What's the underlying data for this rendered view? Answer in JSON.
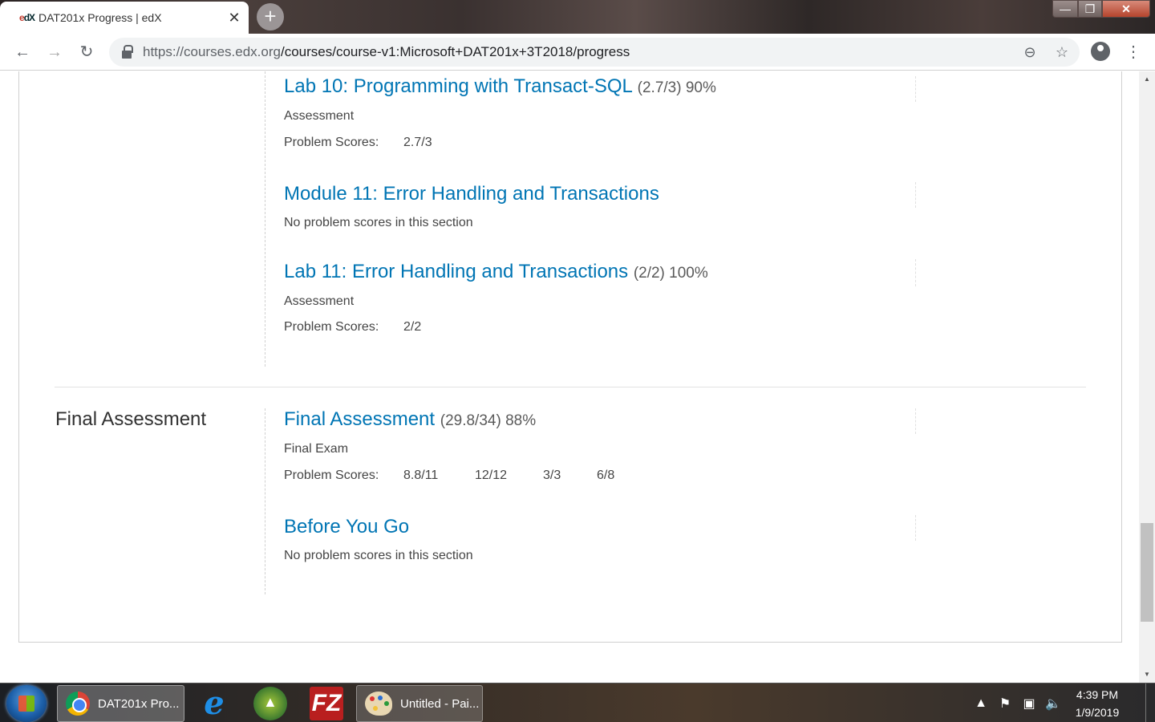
{
  "browser": {
    "tab_title": "DAT201x Progress | edX",
    "favicon_text": "edX",
    "tab_close": "✕",
    "new_tab": "+",
    "url_host": "https://courses.edx.org",
    "url_path": "/courses/course-v1:Microsoft+DAT201x+3T2018/progress",
    "win_min": "—",
    "win_max": "❐",
    "win_close": "✕",
    "back": "←",
    "forward": "→",
    "reload": "↻",
    "zoom": "⊖",
    "star": "☆",
    "menu": "⋮"
  },
  "sections": [
    {
      "title": "Lab 10: Programming with Transact-SQL",
      "score": "(2.7/3) 90%",
      "format": "Assessment",
      "problem_scores_label": "Problem Scores:",
      "problem_scores": [
        "2.7/3"
      ]
    },
    {
      "title": "Module 11: Error Handling and Transactions",
      "note": "No problem scores in this section"
    },
    {
      "title": "Lab 11: Error Handling and Transactions",
      "score": "(2/2) 100%",
      "format": "Assessment",
      "problem_scores_label": "Problem Scores:",
      "problem_scores": [
        "2/2"
      ]
    }
  ],
  "final_chapter": {
    "title": "Final Assessment",
    "sections": [
      {
        "title": "Final Assessment",
        "score": "(29.8/34) 88%",
        "format": "Final Exam",
        "problem_scores_label": "Problem Scores:",
        "problem_scores": [
          "8.8/11",
          "12/12",
          "3/3",
          "6/8"
        ]
      },
      {
        "title": "Before You Go",
        "note": "No problem scores in this section"
      }
    ]
  },
  "taskbar": {
    "chrome_label": "DAT201x Pro...",
    "paint_label": "Untitled - Pai...",
    "filezilla_glyph": "FZ",
    "ie_glyph": "e",
    "time": "4:39 PM",
    "date": "1/9/2019"
  },
  "colors": {
    "link": "#0075b4",
    "text": "#454545"
  }
}
